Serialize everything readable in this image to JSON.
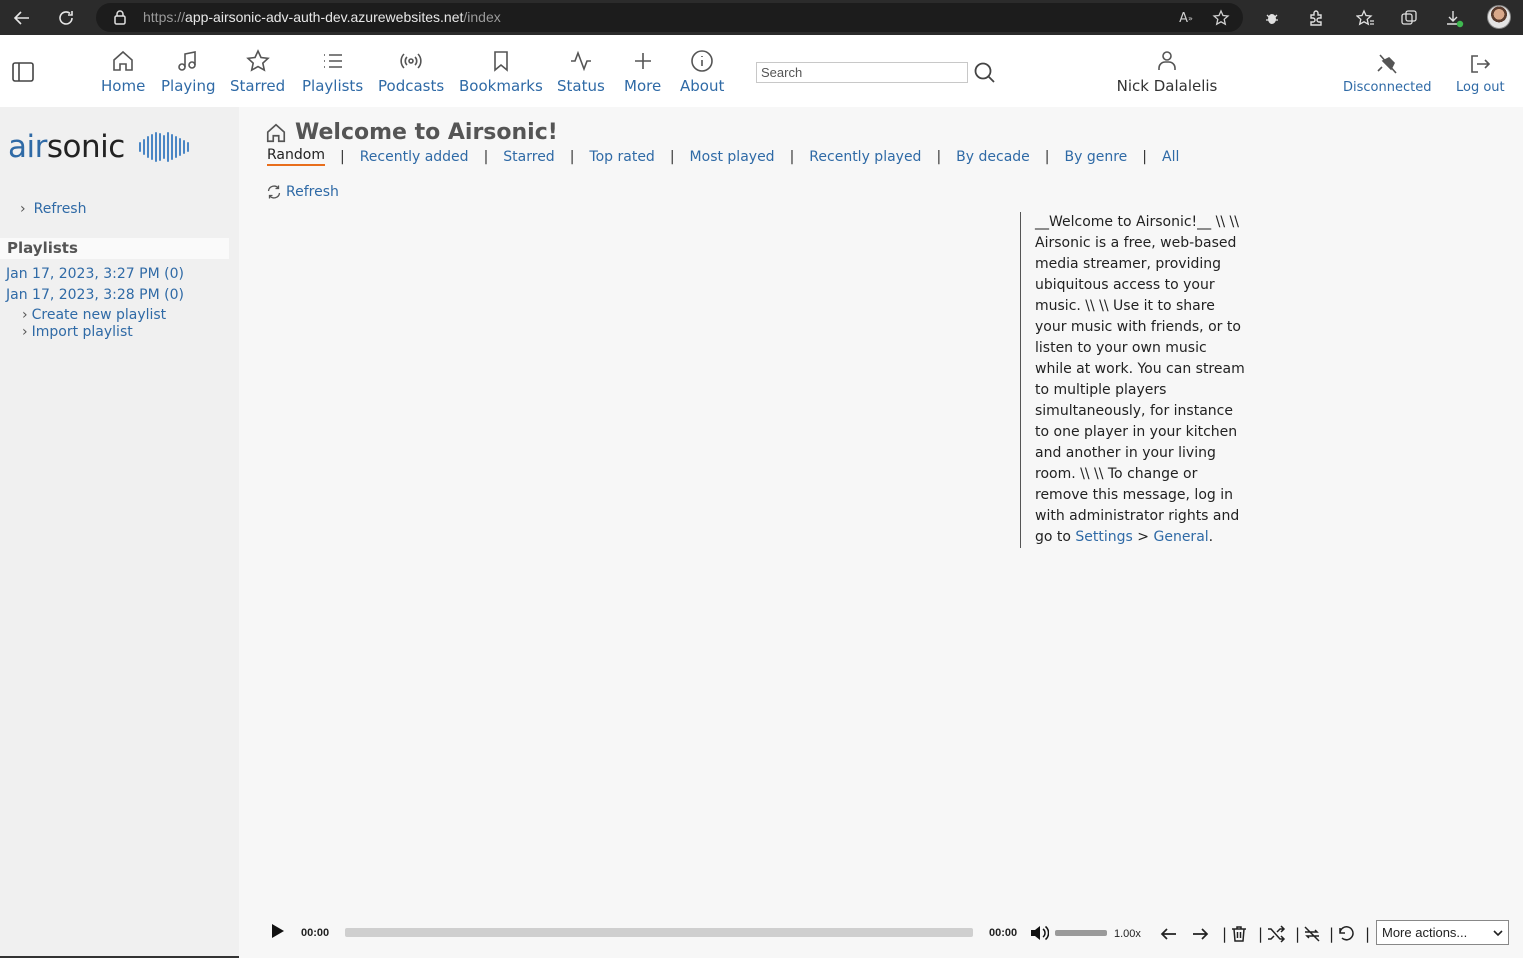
{
  "browser": {
    "url_prefix": "https://",
    "url_host": "app-airsonic-adv-auth-dev.azurewebsites.net",
    "url_path": "/index"
  },
  "nav": {
    "items": [
      {
        "label": "Home",
        "icon": "home-icon"
      },
      {
        "label": "Playing",
        "icon": "music-note-icon"
      },
      {
        "label": "Starred",
        "icon": "star-icon"
      },
      {
        "label": "Playlists",
        "icon": "list-icon"
      },
      {
        "label": "Podcasts",
        "icon": "broadcast-icon"
      },
      {
        "label": "Bookmarks",
        "icon": "bookmark-icon"
      },
      {
        "label": "Status",
        "icon": "activity-icon"
      },
      {
        "label": "More",
        "icon": "plus-icon"
      },
      {
        "label": "About",
        "icon": "info-icon"
      }
    ],
    "search_placeholder": "Search",
    "user_name": "Nick Dalalelis",
    "disconnected_label": "Disconnected",
    "logout_label": "Log out"
  },
  "sidebar": {
    "logo_text_a": "air",
    "logo_text_b": "sonic",
    "refresh_label": "Refresh",
    "playlists_heading": "Playlists",
    "playlists": [
      "Jan 17, 2023, 3:27 PM (0)",
      "Jan 17, 2023, 3:28 PM (0)"
    ],
    "actions": [
      "Create new playlist",
      "Import playlist"
    ]
  },
  "main": {
    "title": "Welcome to Airsonic!",
    "tabs": [
      "Random",
      "Recently added",
      "Starred",
      "Top rated",
      "Most played",
      "Recently played",
      "By decade",
      "By genre",
      "All"
    ],
    "active_tab": "Random",
    "refresh_label": "Refresh",
    "welcome_text": "__Welcome to Airsonic!__ \\\\ \\\\ Airsonic is a free, web-based media streamer, providing ubiquitous access to your music. \\\\ \\\\ Use it to share your music with friends, or to listen to your own music while at work. You can stream to multiple players simultaneously, for instance to one player in your kitchen and another in your living room. \\\\ \\\\ To change or remove this message, log in with administrator rights and go to",
    "welcome_link_settings": "Settings",
    "welcome_link_gt": ">",
    "welcome_link_general": "General",
    "welcome_end": "."
  },
  "player": {
    "current_time": "00:00",
    "duration": "00:00",
    "speed": "1.00x",
    "progress": 0,
    "volume": 1.0,
    "more_actions": "More actions..."
  },
  "colors": {
    "accent": "#2f6aa6",
    "active_tab_underline": "#e86e1c"
  }
}
